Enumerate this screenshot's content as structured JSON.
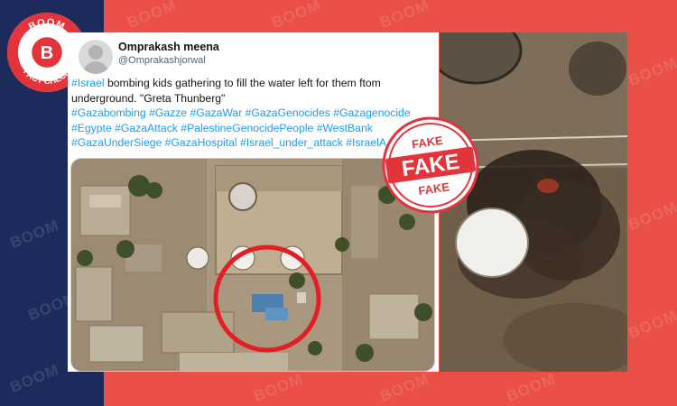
{
  "brand": {
    "logo_top": "BOOM",
    "logo_letter": "B",
    "logo_bottom": "FACT CHECK",
    "watermark": "BOOM",
    "navy": "#1d2a5c",
    "red": "#ea5048"
  },
  "tweet": {
    "user_name": "Omprakash meena",
    "handle": "@Omprakashjorwal",
    "text_line1_tag": "#Israel",
    "text_line1_rest": " bombing kids gathering to fill the water left for them ftom",
    "text_line2": "underground. \"Greta Thunberg\"",
    "hashtags": [
      "#Gazabombing",
      "#Gazze",
      "#GazaWar",
      "#GazaGenocides",
      "#Gazagenocide",
      "#Egypte",
      "#GazaAttack",
      "#PalestineGenocidePeople",
      "#WestBank",
      "#GazaUnderSiege",
      "#GazaHospital",
      "#Israel_under_attack",
      "#IsraelA"
    ],
    "link_color": "#1d9bf0"
  },
  "stamp": {
    "top": "FAKE",
    "main": "FAKE",
    "bottom": "FAKE",
    "color": "#e2343a"
  }
}
